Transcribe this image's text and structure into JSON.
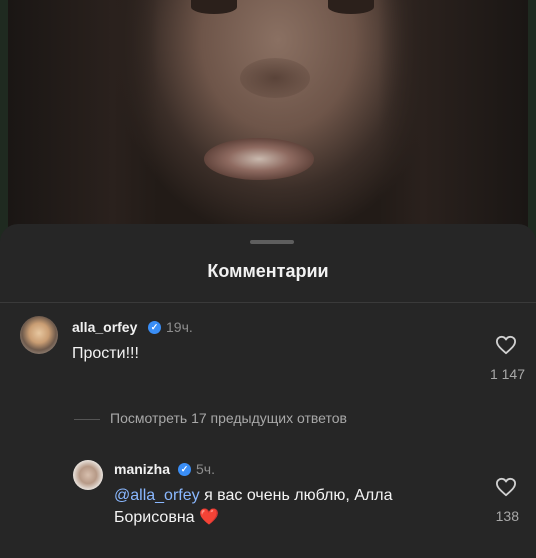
{
  "sheet": {
    "title": "Комментарии"
  },
  "comments": [
    {
      "username": "alla_orfey",
      "verified": true,
      "time": "19ч.",
      "text": "Прости!!!",
      "likes": "1 147",
      "view_replies": "Посмотреть 17 предыдущих ответов"
    }
  ],
  "reply": {
    "username": "manizha",
    "verified": true,
    "time": "5ч.",
    "mention": "@alla_orfey",
    "text_line1_rest": " я вас очень люблю, Алла",
    "text_line2": "Борисовна",
    "emoji": "❤️",
    "likes": "138"
  },
  "icons": {
    "verified": "verified-badge-icon",
    "like": "heart-outline-icon"
  },
  "colors": {
    "sheet_bg": "#262626",
    "verified_blue": "#3a8ef6",
    "mention": "#8ab8ff",
    "heart_emoji": "#e0245e"
  }
}
